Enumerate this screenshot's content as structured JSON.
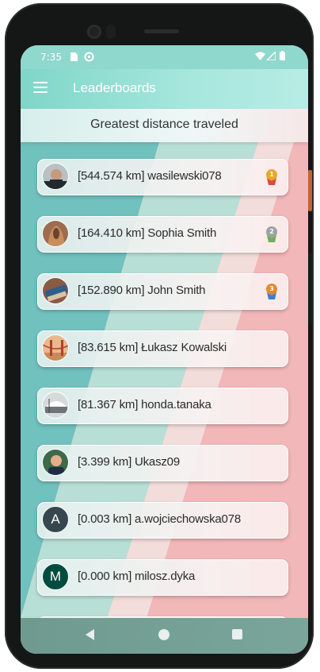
{
  "status_bar": {
    "time": "7:35",
    "icons": [
      "sim-card-icon",
      "sync-icon",
      "wifi-icon",
      "signal-icon",
      "battery-icon"
    ]
  },
  "app_bar": {
    "title": "Leaderboards",
    "menu_icon": "menu-icon"
  },
  "category": "Greatest distance traveled",
  "leaderboard": [
    {
      "label": "[544.574 km] wasilewski078",
      "avatar": "photo",
      "medal": "1"
    },
    {
      "label": "[164.410 km] Sophia Smith",
      "avatar": "photo",
      "medal": "2"
    },
    {
      "label": "[152.890 km] John Smith",
      "avatar": "photo",
      "medal": "3"
    },
    {
      "label": "[83.615 km] Łukasz Kowalski",
      "avatar": "photo"
    },
    {
      "label": "[81.367 km] honda.tanaka",
      "avatar": "photo"
    },
    {
      "label": "[3.399 km] Ukasz09",
      "avatar": "photo"
    },
    {
      "label": "[0.003 km] a.wojciechowska078",
      "avatar": "A"
    },
    {
      "label": "[0.000 km] milosz.dyka",
      "avatar": "M"
    }
  ],
  "colors": {
    "teal": "#8fd8cd",
    "pink": "#f2b7b8",
    "gold": "#e9a825",
    "silver": "#9aa3a2",
    "bronze": "#e48a2d",
    "avatar_a": "#37474f",
    "avatar_m": "#004d40"
  }
}
